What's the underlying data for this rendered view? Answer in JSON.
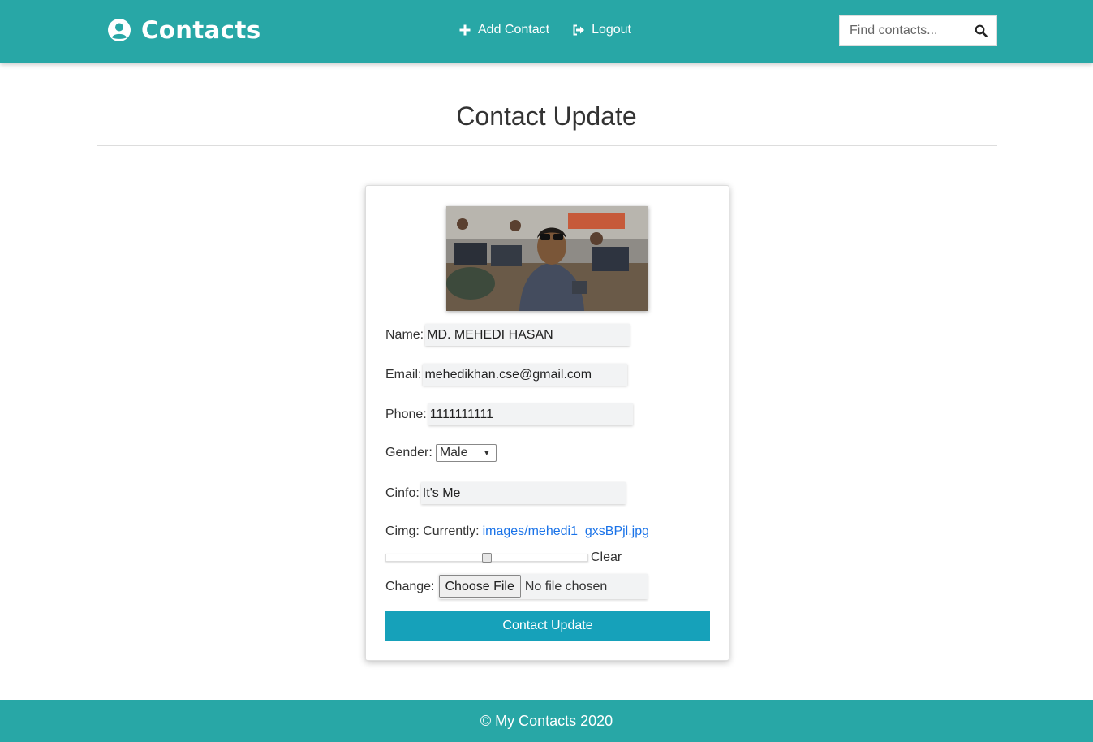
{
  "navbar": {
    "brand": "Contacts",
    "links": [
      {
        "label": "Add Contact",
        "icon": "plus-icon"
      },
      {
        "label": "Logout",
        "icon": "logout-icon"
      }
    ],
    "search_placeholder": "Find contacts...",
    "background": "#28a7a6"
  },
  "page": {
    "title": "Contact Update"
  },
  "form": {
    "name_label": "Name:",
    "name_value": "MD. MEHEDI HASAN",
    "email_label": "Email:",
    "email_value": "mehedikhan.cse@gmail.com",
    "phone_label": "Phone:",
    "phone_value": "1111111111",
    "gender_label": "Gender:",
    "gender_value": "Male",
    "cinfo_label": "Cinfo:",
    "cinfo_value": "It's Me",
    "cimg_label": "Cimg: Currently:",
    "cimg_link": "images/mehedi1_gxsBPjl.jpg",
    "clear_label": "Clear",
    "change_label": "Change:",
    "choose_file_label": "Choose File",
    "no_file_text": "No file chosen",
    "submit_label": "Contact Update",
    "submit_color": "#16a1ba"
  },
  "footer": {
    "text": "© My Contacts 2020"
  }
}
